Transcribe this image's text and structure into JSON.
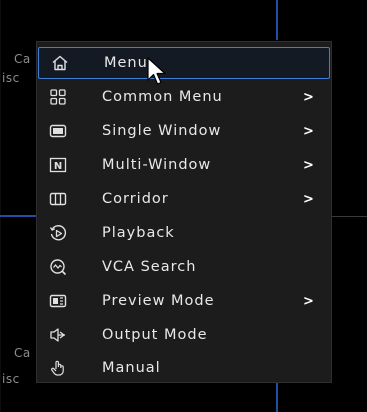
{
  "background": {
    "fragments": [
      "Ca",
      "isc",
      "Ca",
      "isc"
    ]
  },
  "menu": {
    "items": [
      {
        "label": "Menu",
        "icon": "home-icon",
        "submenu": false,
        "highlighted": true
      },
      {
        "label": "Common Menu",
        "icon": "grid-four-icon",
        "submenu": true
      },
      {
        "label": "Single Window",
        "icon": "single-window-icon",
        "submenu": true
      },
      {
        "label": "Multi-Window",
        "icon": "multi-window-icon",
        "submenu": true
      },
      {
        "label": "Corridor",
        "icon": "corridor-icon",
        "submenu": true
      },
      {
        "label": "Playback",
        "icon": "playback-icon",
        "submenu": false
      },
      {
        "label": "VCA Search",
        "icon": "vca-search-icon",
        "submenu": false
      },
      {
        "label": "Preview Mode",
        "icon": "preview-mode-icon",
        "submenu": true
      },
      {
        "label": "Output Mode",
        "icon": "output-mode-icon",
        "submenu": false
      },
      {
        "label": "Manual",
        "icon": "manual-hand-icon",
        "submenu": false
      }
    ],
    "submenu_glyph": ">"
  },
  "colors": {
    "menu_bg": "#1c1c1c",
    "highlight_border": "#3d7fd6",
    "grid_line": "#1f4ea6",
    "text": "#e8e8e8"
  }
}
